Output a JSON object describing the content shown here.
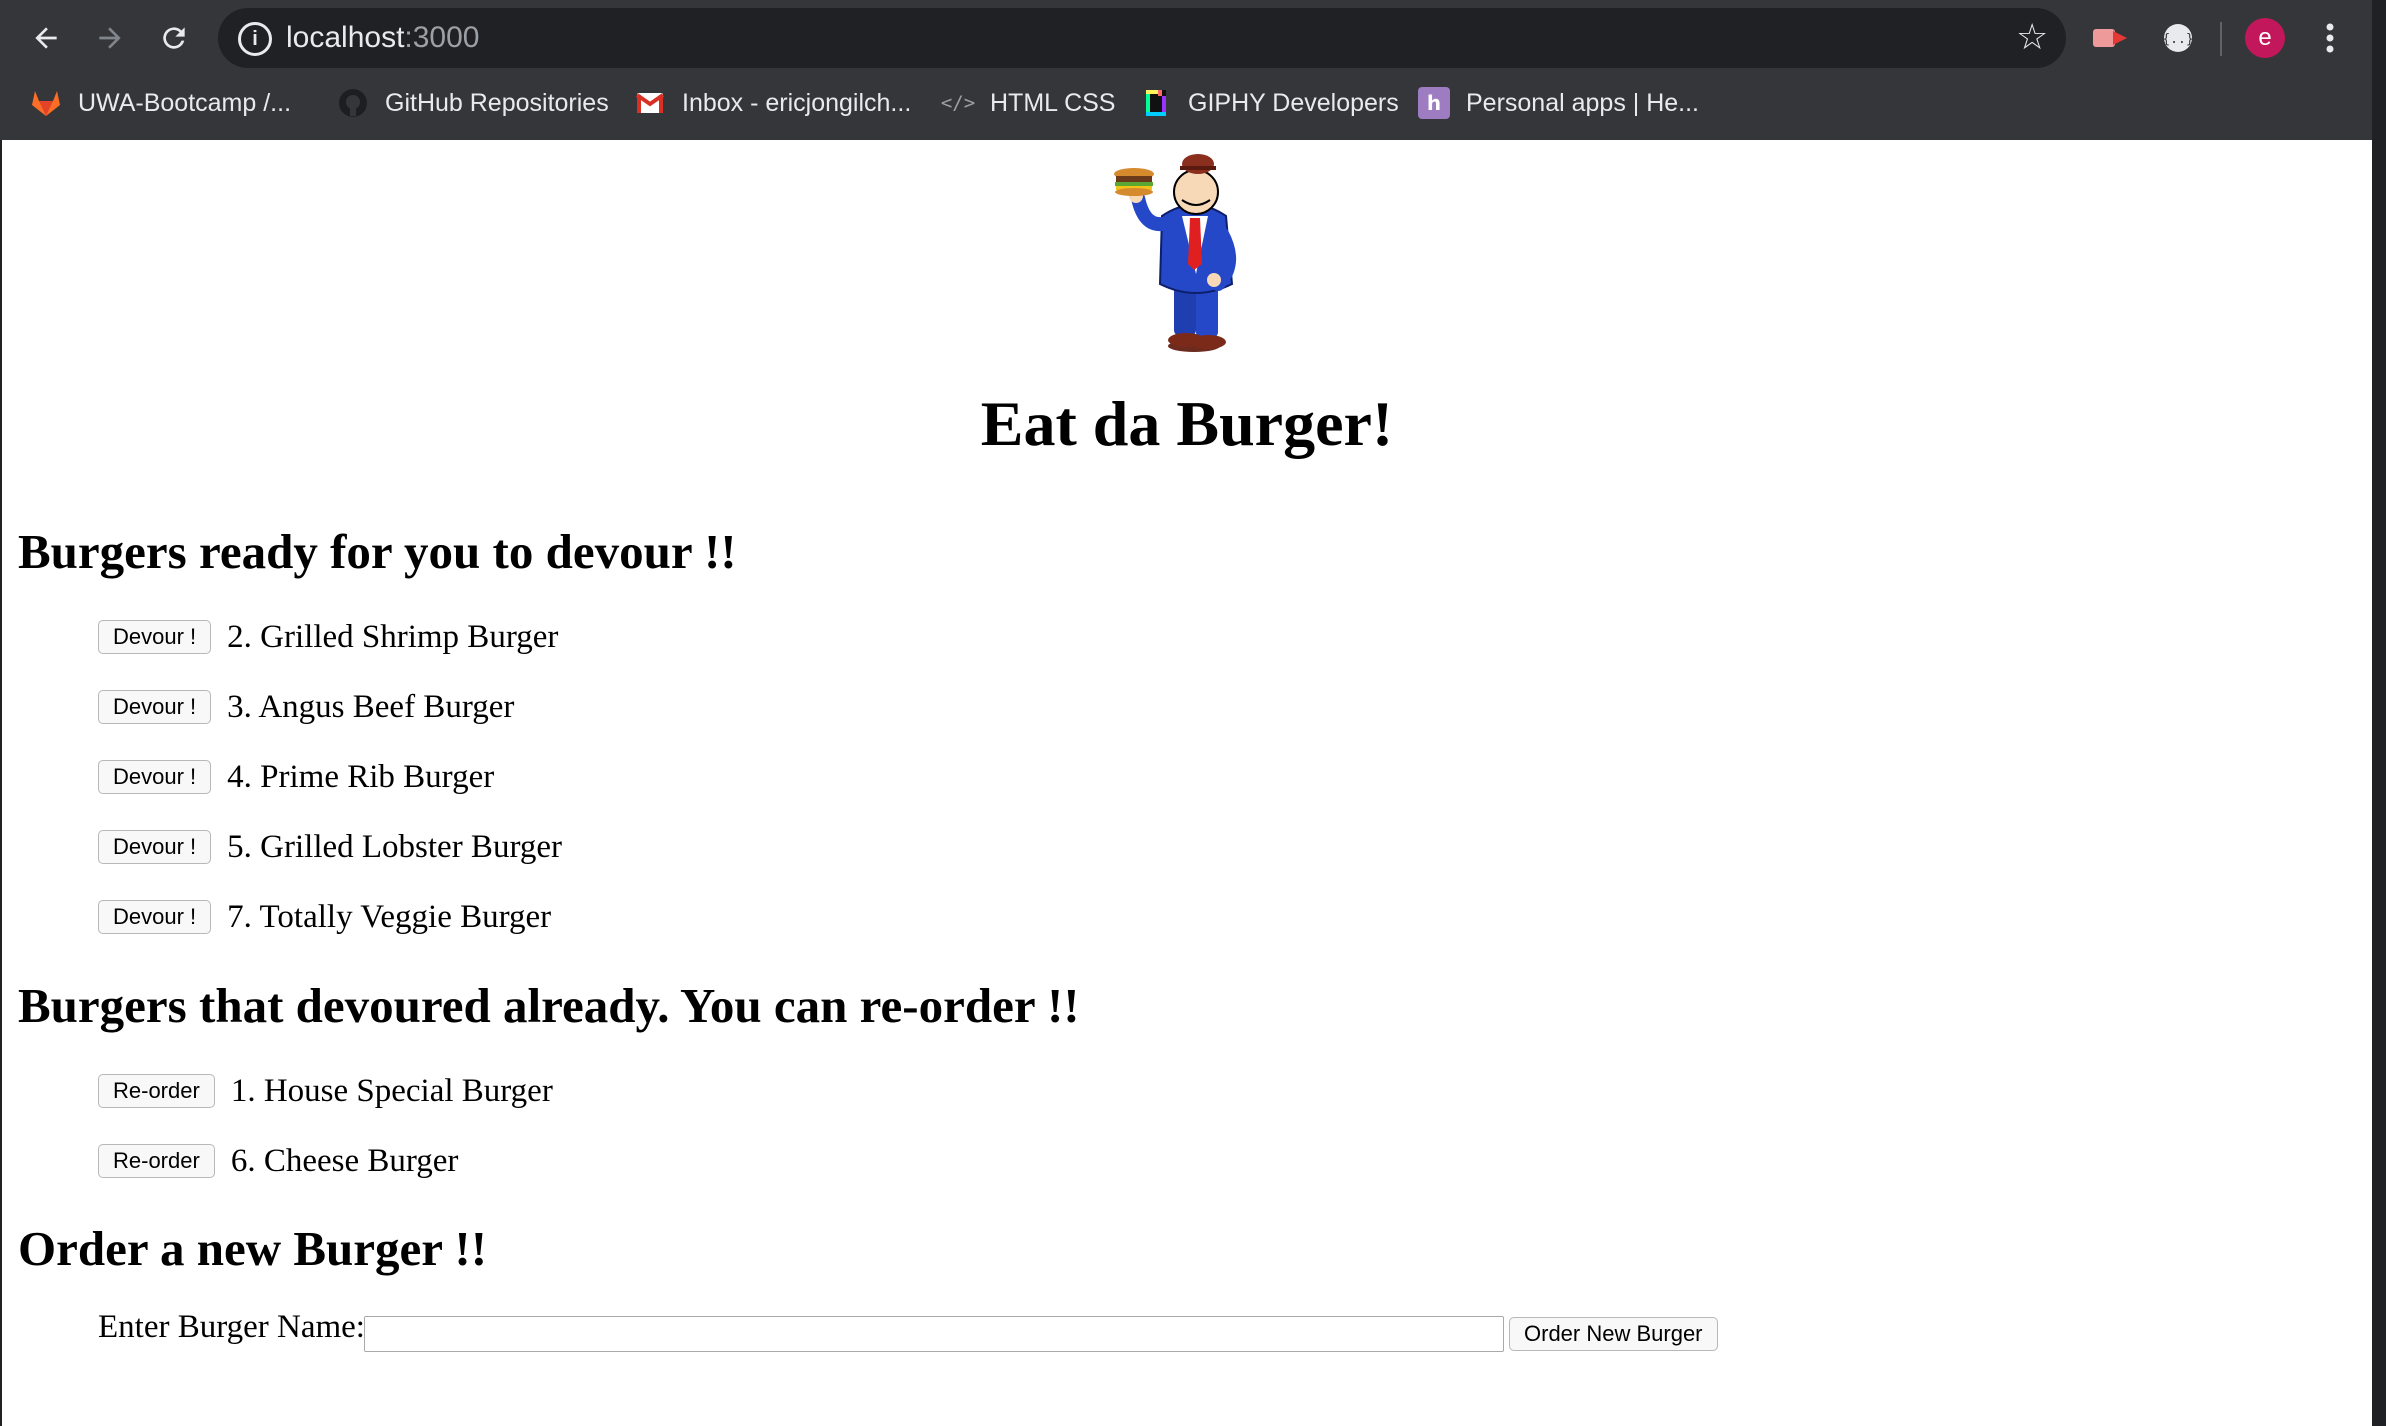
{
  "browser": {
    "url_host": "localhost",
    "url_port": ":3000",
    "avatar_letter": "e",
    "bookmarks": [
      {
        "label": "UWA-Bootcamp /...",
        "icon": "gitlab-icon"
      },
      {
        "label": "GitHub Repositories",
        "icon": "github-icon"
      },
      {
        "label": "Inbox - ericjongilch...",
        "icon": "gmail-icon"
      },
      {
        "label": "HTML CSS",
        "icon": "code-icon"
      },
      {
        "label": "GIPHY Developers",
        "icon": "giphy-icon"
      },
      {
        "label": "Personal apps | He...",
        "icon": "heroku-icon"
      }
    ],
    "colors": {
      "avatar": "#c2185b",
      "chrome": "#35363a"
    }
  },
  "page": {
    "title": "Eat da Burger!",
    "ready_heading": "Burgers ready for you to devour !!",
    "ready_items": [
      {
        "button": "Devour !",
        "text": "2. Grilled Shrimp Burger"
      },
      {
        "button": "Devour !",
        "text": "3. Angus Beef Burger"
      },
      {
        "button": "Devour !",
        "text": "4. Prime Rib Burger"
      },
      {
        "button": "Devour !",
        "text": "5. Grilled Lobster Burger"
      },
      {
        "button": "Devour !",
        "text": "7. Totally Veggie Burger"
      }
    ],
    "devoured_heading": "Burgers that devoured already. You can re-order !!",
    "devoured_items": [
      {
        "button": "Re-order",
        "text": "1. House Special Burger"
      },
      {
        "button": "Re-order",
        "text": "6. Cheese Burger"
      }
    ],
    "order_heading": "Order a new Burger !!",
    "order_label": "Enter Burger Name:",
    "order_input_value": "",
    "order_button": "Order New Burger"
  }
}
